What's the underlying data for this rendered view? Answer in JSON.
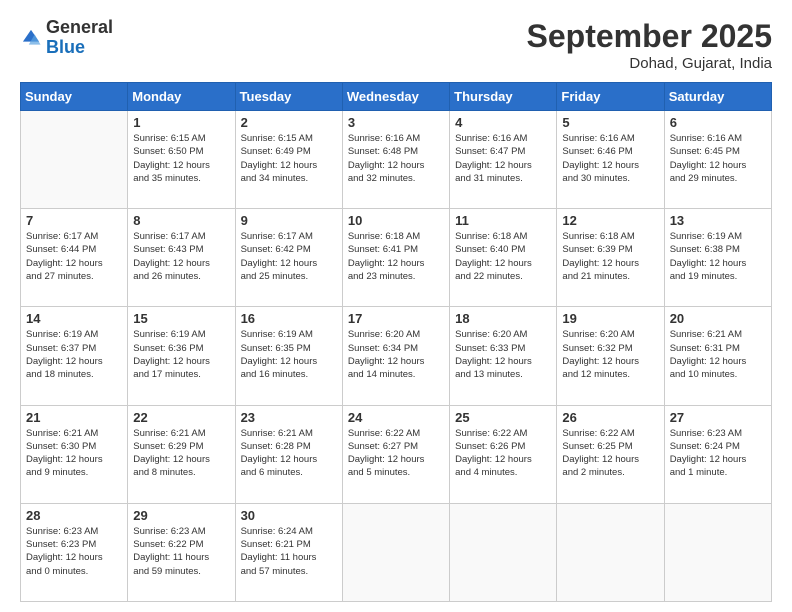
{
  "header": {
    "logo_general": "General",
    "logo_blue": "Blue",
    "month_title": "September 2025",
    "location": "Dohad, Gujarat, India"
  },
  "weekdays": [
    "Sunday",
    "Monday",
    "Tuesday",
    "Wednesday",
    "Thursday",
    "Friday",
    "Saturday"
  ],
  "weeks": [
    [
      {
        "day": "",
        "info": ""
      },
      {
        "day": "1",
        "info": "Sunrise: 6:15 AM\nSunset: 6:50 PM\nDaylight: 12 hours\nand 35 minutes."
      },
      {
        "day": "2",
        "info": "Sunrise: 6:15 AM\nSunset: 6:49 PM\nDaylight: 12 hours\nand 34 minutes."
      },
      {
        "day": "3",
        "info": "Sunrise: 6:16 AM\nSunset: 6:48 PM\nDaylight: 12 hours\nand 32 minutes."
      },
      {
        "day": "4",
        "info": "Sunrise: 6:16 AM\nSunset: 6:47 PM\nDaylight: 12 hours\nand 31 minutes."
      },
      {
        "day": "5",
        "info": "Sunrise: 6:16 AM\nSunset: 6:46 PM\nDaylight: 12 hours\nand 30 minutes."
      },
      {
        "day": "6",
        "info": "Sunrise: 6:16 AM\nSunset: 6:45 PM\nDaylight: 12 hours\nand 29 minutes."
      }
    ],
    [
      {
        "day": "7",
        "info": "Sunrise: 6:17 AM\nSunset: 6:44 PM\nDaylight: 12 hours\nand 27 minutes."
      },
      {
        "day": "8",
        "info": "Sunrise: 6:17 AM\nSunset: 6:43 PM\nDaylight: 12 hours\nand 26 minutes."
      },
      {
        "day": "9",
        "info": "Sunrise: 6:17 AM\nSunset: 6:42 PM\nDaylight: 12 hours\nand 25 minutes."
      },
      {
        "day": "10",
        "info": "Sunrise: 6:18 AM\nSunset: 6:41 PM\nDaylight: 12 hours\nand 23 minutes."
      },
      {
        "day": "11",
        "info": "Sunrise: 6:18 AM\nSunset: 6:40 PM\nDaylight: 12 hours\nand 22 minutes."
      },
      {
        "day": "12",
        "info": "Sunrise: 6:18 AM\nSunset: 6:39 PM\nDaylight: 12 hours\nand 21 minutes."
      },
      {
        "day": "13",
        "info": "Sunrise: 6:19 AM\nSunset: 6:38 PM\nDaylight: 12 hours\nand 19 minutes."
      }
    ],
    [
      {
        "day": "14",
        "info": "Sunrise: 6:19 AM\nSunset: 6:37 PM\nDaylight: 12 hours\nand 18 minutes."
      },
      {
        "day": "15",
        "info": "Sunrise: 6:19 AM\nSunset: 6:36 PM\nDaylight: 12 hours\nand 17 minutes."
      },
      {
        "day": "16",
        "info": "Sunrise: 6:19 AM\nSunset: 6:35 PM\nDaylight: 12 hours\nand 16 minutes."
      },
      {
        "day": "17",
        "info": "Sunrise: 6:20 AM\nSunset: 6:34 PM\nDaylight: 12 hours\nand 14 minutes."
      },
      {
        "day": "18",
        "info": "Sunrise: 6:20 AM\nSunset: 6:33 PM\nDaylight: 12 hours\nand 13 minutes."
      },
      {
        "day": "19",
        "info": "Sunrise: 6:20 AM\nSunset: 6:32 PM\nDaylight: 12 hours\nand 12 minutes."
      },
      {
        "day": "20",
        "info": "Sunrise: 6:21 AM\nSunset: 6:31 PM\nDaylight: 12 hours\nand 10 minutes."
      }
    ],
    [
      {
        "day": "21",
        "info": "Sunrise: 6:21 AM\nSunset: 6:30 PM\nDaylight: 12 hours\nand 9 minutes."
      },
      {
        "day": "22",
        "info": "Sunrise: 6:21 AM\nSunset: 6:29 PM\nDaylight: 12 hours\nand 8 minutes."
      },
      {
        "day": "23",
        "info": "Sunrise: 6:21 AM\nSunset: 6:28 PM\nDaylight: 12 hours\nand 6 minutes."
      },
      {
        "day": "24",
        "info": "Sunrise: 6:22 AM\nSunset: 6:27 PM\nDaylight: 12 hours\nand 5 minutes."
      },
      {
        "day": "25",
        "info": "Sunrise: 6:22 AM\nSunset: 6:26 PM\nDaylight: 12 hours\nand 4 minutes."
      },
      {
        "day": "26",
        "info": "Sunrise: 6:22 AM\nSunset: 6:25 PM\nDaylight: 12 hours\nand 2 minutes."
      },
      {
        "day": "27",
        "info": "Sunrise: 6:23 AM\nSunset: 6:24 PM\nDaylight: 12 hours\nand 1 minute."
      }
    ],
    [
      {
        "day": "28",
        "info": "Sunrise: 6:23 AM\nSunset: 6:23 PM\nDaylight: 12 hours\nand 0 minutes."
      },
      {
        "day": "29",
        "info": "Sunrise: 6:23 AM\nSunset: 6:22 PM\nDaylight: 11 hours\nand 59 minutes."
      },
      {
        "day": "30",
        "info": "Sunrise: 6:24 AM\nSunset: 6:21 PM\nDaylight: 11 hours\nand 57 minutes."
      },
      {
        "day": "",
        "info": ""
      },
      {
        "day": "",
        "info": ""
      },
      {
        "day": "",
        "info": ""
      },
      {
        "day": "",
        "info": ""
      }
    ]
  ]
}
